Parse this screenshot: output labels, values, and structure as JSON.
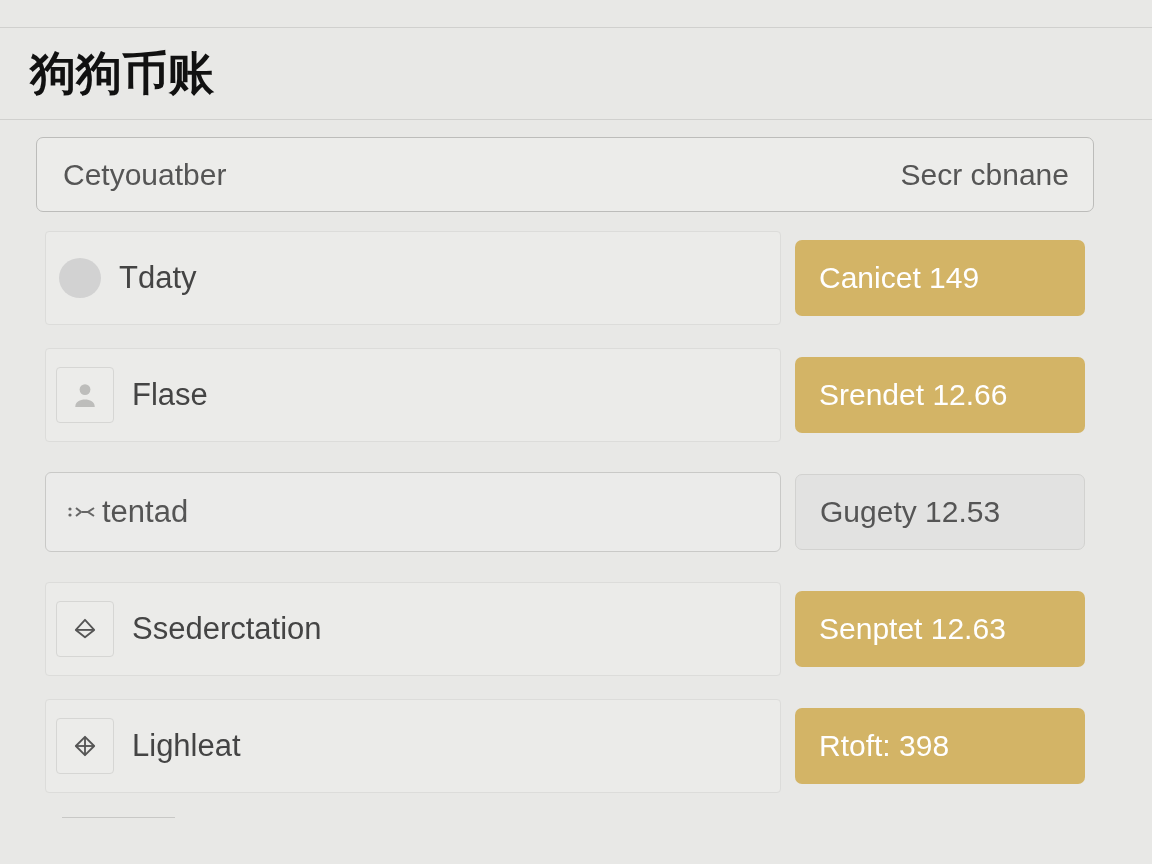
{
  "title": "狗狗币账",
  "search": {
    "value": "Cetyouatber",
    "trailing_label": "Secr cbnane"
  },
  "rows": [
    {
      "kind": "item",
      "label": "Tdaty",
      "action": {
        "label": "Canicet 149",
        "disabled": false
      }
    },
    {
      "kind": "item",
      "label": "Flase",
      "action": {
        "label": "Srendet 12.66",
        "disabled": false
      }
    },
    {
      "kind": "field",
      "value": "tentad",
      "action": {
        "label": "Gugety 12.53",
        "disabled": true
      }
    },
    {
      "kind": "item",
      "label": "Ssederctation",
      "action": {
        "label": "Senptet 12.63",
        "disabled": false
      }
    },
    {
      "kind": "item",
      "label": "Lighleat",
      "action": {
        "label": "Rtoft: 398",
        "disabled": false
      }
    }
  ]
}
